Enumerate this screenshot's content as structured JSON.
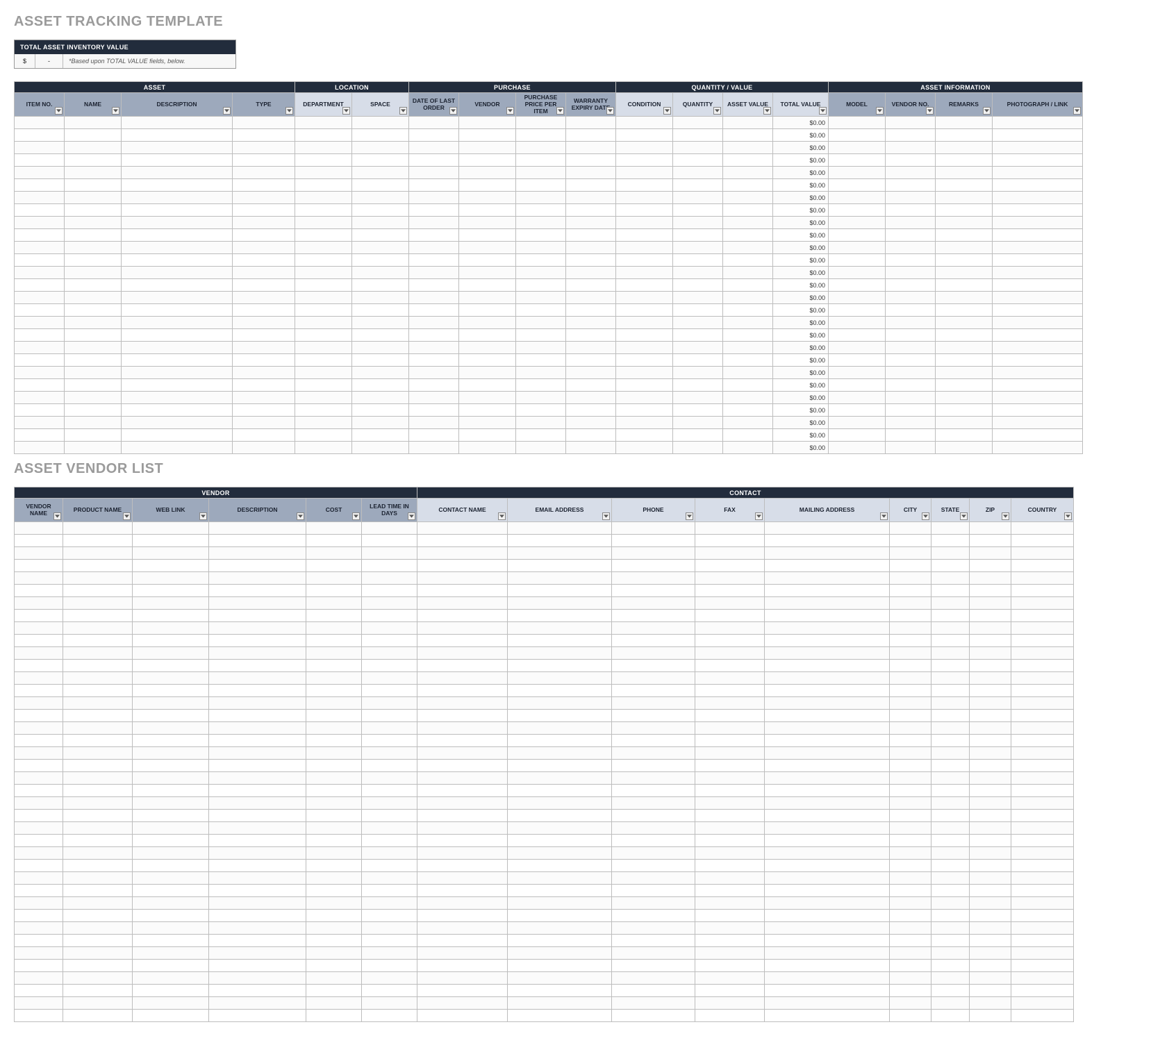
{
  "title1": "ASSET TRACKING TEMPLATE",
  "title2": "ASSET VENDOR LIST",
  "summary": {
    "header": "TOTAL ASSET INVENTORY VALUE",
    "currency": "$",
    "value": "-",
    "note": "*Based upon TOTAL VALUE fields, below."
  },
  "asset_table": {
    "groups": [
      {
        "label": "ASSET",
        "span": 4
      },
      {
        "label": "LOCATION",
        "span": 2
      },
      {
        "label": "PURCHASE",
        "span": 4
      },
      {
        "label": "QUANTITY / VALUE",
        "span": 4
      },
      {
        "label": "ASSET INFORMATION",
        "span": 4
      }
    ],
    "columns": [
      {
        "label": "ITEM NO.",
        "shade": "dark",
        "w": "w-xs"
      },
      {
        "label": "NAME",
        "shade": "dark",
        "w": "w-sm"
      },
      {
        "label": "DESCRIPTION",
        "shade": "dark",
        "w": "w-desc"
      },
      {
        "label": "TYPE",
        "shade": "dark",
        "w": "w-type"
      },
      {
        "label": "DEPARTMENT",
        "shade": "light",
        "w": "w-sm"
      },
      {
        "label": "SPACE",
        "shade": "light",
        "w": "w-sm"
      },
      {
        "label": "DATE OF LAST ORDER",
        "shade": "dark",
        "w": "w-xs"
      },
      {
        "label": "VENDOR",
        "shade": "dark",
        "w": "w-sm"
      },
      {
        "label": "PURCHASE PRICE PER ITEM",
        "shade": "dark",
        "w": "w-xs"
      },
      {
        "label": "WARRANTY EXPIRY DATE",
        "shade": "dark",
        "w": "w-xs"
      },
      {
        "label": "CONDITION",
        "shade": "light",
        "w": "w-sm"
      },
      {
        "label": "QUANTITY",
        "shade": "light",
        "w": "w-xs"
      },
      {
        "label": "ASSET VALUE",
        "shade": "light",
        "w": "w-xs"
      },
      {
        "label": "TOTAL VALUE",
        "shade": "light",
        "w": "w-tv"
      },
      {
        "label": "MODEL",
        "shade": "dark",
        "w": "w-sm"
      },
      {
        "label": "VENDOR NO.",
        "shade": "dark",
        "w": "w-xs"
      },
      {
        "label": "REMARKS",
        "shade": "dark",
        "w": "w-sm"
      },
      {
        "label": "PHOTOGRAPH / LINK",
        "shade": "dark",
        "w": "w-photo"
      }
    ],
    "total_value_default": "$0.00",
    "row_count": 27,
    "total_value_col_index": 13
  },
  "vendor_table": {
    "groups": [
      {
        "label": "VENDOR",
        "span": 6
      },
      {
        "label": "CONTACT",
        "span": 9
      }
    ],
    "columns": [
      {
        "label": "VENDOR NAME",
        "shade": "dark",
        "w": "v-name"
      },
      {
        "label": "PRODUCT NAME",
        "shade": "dark",
        "w": "v-prod"
      },
      {
        "label": "WEB LINK",
        "shade": "dark",
        "w": "v-link"
      },
      {
        "label": "DESCRIPTION",
        "shade": "dark",
        "w": "v-desc"
      },
      {
        "label": "COST",
        "shade": "dark",
        "w": "v-cost"
      },
      {
        "label": "LEAD TIME IN DAYS",
        "shade": "dark",
        "w": "v-lead"
      },
      {
        "label": "CONTACT NAME",
        "shade": "light",
        "w": "v-cname"
      },
      {
        "label": "EMAIL ADDRESS",
        "shade": "light",
        "w": "v-email"
      },
      {
        "label": "PHONE",
        "shade": "light",
        "w": "v-phone"
      },
      {
        "label": "FAX",
        "shade": "light",
        "w": "v-fax"
      },
      {
        "label": "MAILING ADDRESS",
        "shade": "light",
        "w": "v-mail"
      },
      {
        "label": "CITY",
        "shade": "light",
        "w": "v-city"
      },
      {
        "label": "STATE",
        "shade": "light",
        "w": "v-state"
      },
      {
        "label": "ZIP",
        "shade": "light",
        "w": "v-zip"
      },
      {
        "label": "COUNTRY",
        "shade": "light",
        "w": "v-ctry"
      }
    ],
    "row_count": 40
  }
}
